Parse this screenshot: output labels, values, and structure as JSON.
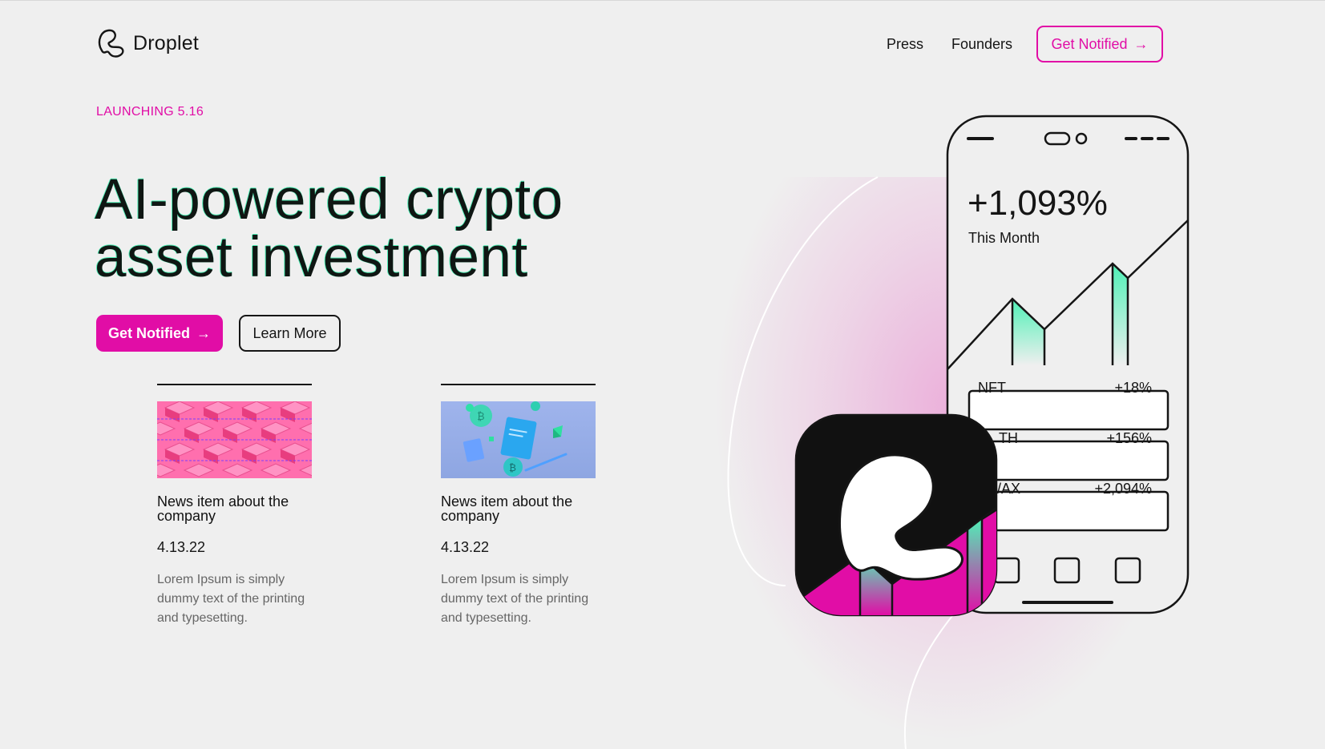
{
  "header": {
    "logo_text": "Droplet",
    "nav": [
      "Press",
      "Founders"
    ],
    "cta_label": "Get Notified",
    "arrow": "→"
  },
  "hero": {
    "eyebrow": "LAUNCHING 5.16",
    "title_line1": "AI-powered crypto",
    "title_line2": "asset investment",
    "primary_label": "Get Notified",
    "secondary_label": "Learn More"
  },
  "news": [
    {
      "title": "News item about the company",
      "date": "4.13.22",
      "desc": "Lorem Ipsum is simply dummy text of the printing and typesetting.",
      "image": "pink-crypto-cubes"
    },
    {
      "title": "News item about the company",
      "date": "4.13.22",
      "desc": "Lorem Ipsum is simply dummy text of the printing and typesetting.",
      "image": "blue-crypto-objects"
    }
  ],
  "phone": {
    "gain": "+1,093%",
    "period": "This Month",
    "assets": [
      {
        "name": "NFT",
        "change": "+18%"
      },
      {
        "name": "TH",
        "change": "+156%"
      },
      {
        "name": "/AX",
        "change": "+2,094%"
      }
    ]
  },
  "colors": {
    "accent": "#e10da6",
    "mint": "#4ff0b6",
    "background": "#efefef",
    "ink": "#151515"
  }
}
